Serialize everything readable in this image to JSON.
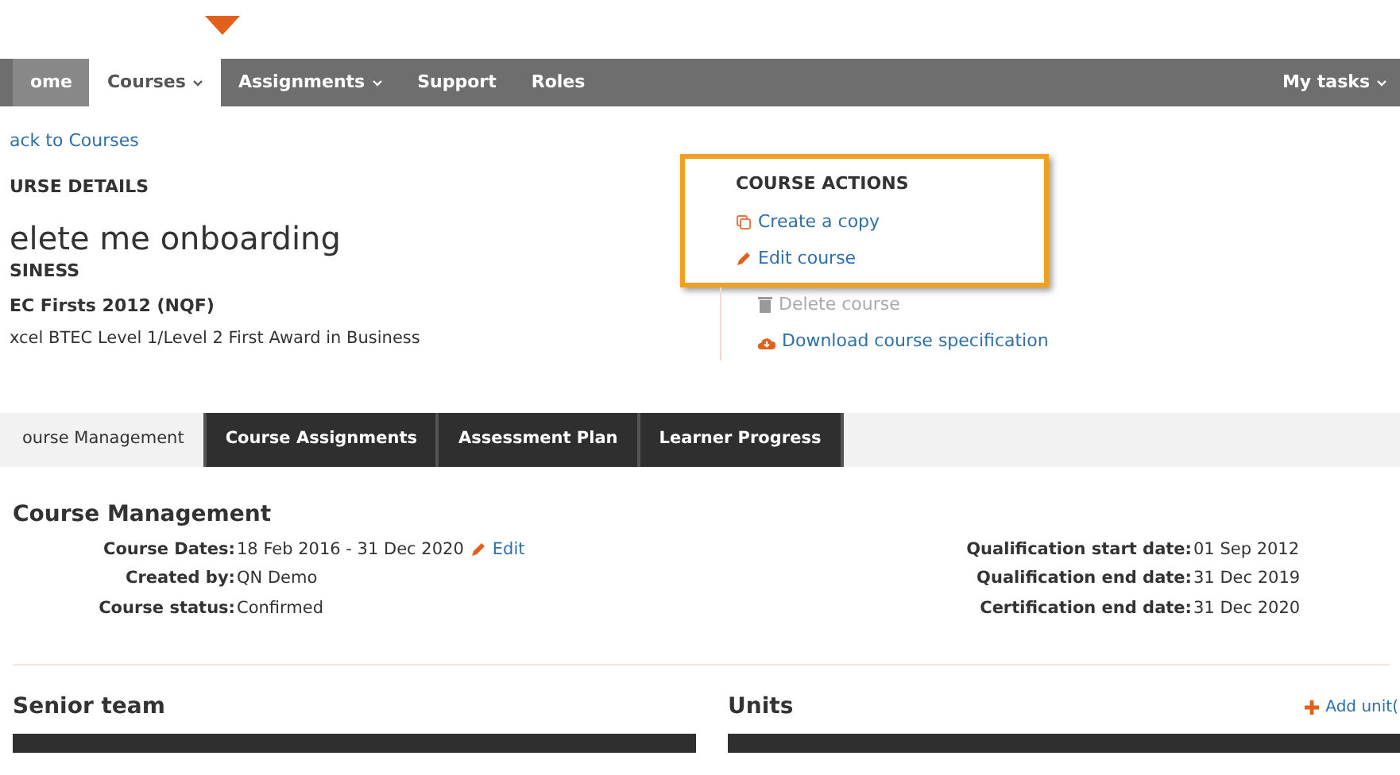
{
  "nav": {
    "items": [
      {
        "label": "ome",
        "selected": false,
        "dropdown": false
      },
      {
        "label": "Courses",
        "selected": true,
        "dropdown": true
      },
      {
        "label": "Assignments",
        "selected": false,
        "dropdown": true
      },
      {
        "label": "Support",
        "selected": false,
        "dropdown": false
      },
      {
        "label": "Roles",
        "selected": false,
        "dropdown": false
      }
    ],
    "right": {
      "label": "My tasks",
      "dropdown": true
    }
  },
  "back_link": "ack to Courses",
  "details": {
    "heading": "URSE DETAILS",
    "title": "elete me onboarding",
    "sector": "SINESS",
    "framework": "EC Firsts 2012 (NQF)",
    "qualification": "xcel BTEC Level 1/Level 2 First Award in Business"
  },
  "actions": {
    "highlighted": {
      "heading": "COURSE ACTIONS",
      "items": [
        {
          "kind": "copy",
          "label": "Create a copy",
          "disabled": false
        },
        {
          "kind": "edit",
          "label": "Edit course",
          "disabled": false
        }
      ]
    },
    "items": [
      {
        "kind": "delete",
        "label": "Delete course",
        "disabled": true
      },
      {
        "kind": "download",
        "label": "Download course specification",
        "disabled": false
      }
    ]
  },
  "tabs": [
    {
      "label": "ourse Management",
      "selected": true
    },
    {
      "label": "Course Assignments",
      "selected": false
    },
    {
      "label": "Assessment Plan",
      "selected": false
    },
    {
      "label": "Learner Progress",
      "selected": false
    }
  ],
  "management": {
    "heading": "Course Management",
    "left": [
      {
        "label": "Course Dates:",
        "value": "18 Feb 2016 - 31 Dec 2020",
        "edit": "Edit"
      },
      {
        "label": "Created by:",
        "value": "QN Demo"
      },
      {
        "label": "Course status:",
        "value": "Confirmed"
      }
    ],
    "right": [
      {
        "label": "Qualification start date:",
        "value": "01 Sep 2012"
      },
      {
        "label": "Qualification end date:",
        "value": "31 Dec 2019"
      },
      {
        "label": "Certification end date:",
        "value": "31 Dec 2020"
      }
    ]
  },
  "senior_team": {
    "heading": "Senior team"
  },
  "units": {
    "heading": "Units",
    "add": "Add unit("
  }
}
